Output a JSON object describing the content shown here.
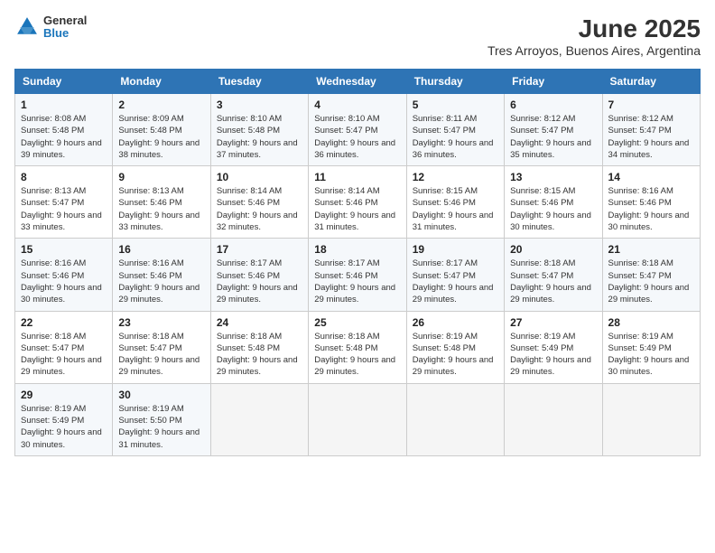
{
  "logo": {
    "general": "General",
    "blue": "Blue"
  },
  "title": "June 2025",
  "subtitle": "Tres Arroyos, Buenos Aires, Argentina",
  "weekdays": [
    "Sunday",
    "Monday",
    "Tuesday",
    "Wednesday",
    "Thursday",
    "Friday",
    "Saturday"
  ],
  "weeks": [
    [
      {
        "day": "1",
        "rise": "Sunrise: 8:08 AM",
        "set": "Sunset: 5:48 PM",
        "daylight": "Daylight: 9 hours and 39 minutes."
      },
      {
        "day": "2",
        "rise": "Sunrise: 8:09 AM",
        "set": "Sunset: 5:48 PM",
        "daylight": "Daylight: 9 hours and 38 minutes."
      },
      {
        "day": "3",
        "rise": "Sunrise: 8:10 AM",
        "set": "Sunset: 5:48 PM",
        "daylight": "Daylight: 9 hours and 37 minutes."
      },
      {
        "day": "4",
        "rise": "Sunrise: 8:10 AM",
        "set": "Sunset: 5:47 PM",
        "daylight": "Daylight: 9 hours and 36 minutes."
      },
      {
        "day": "5",
        "rise": "Sunrise: 8:11 AM",
        "set": "Sunset: 5:47 PM",
        "daylight": "Daylight: 9 hours and 36 minutes."
      },
      {
        "day": "6",
        "rise": "Sunrise: 8:12 AM",
        "set": "Sunset: 5:47 PM",
        "daylight": "Daylight: 9 hours and 35 minutes."
      },
      {
        "day": "7",
        "rise": "Sunrise: 8:12 AM",
        "set": "Sunset: 5:47 PM",
        "daylight": "Daylight: 9 hours and 34 minutes."
      }
    ],
    [
      {
        "day": "8",
        "rise": "Sunrise: 8:13 AM",
        "set": "Sunset: 5:47 PM",
        "daylight": "Daylight: 9 hours and 33 minutes."
      },
      {
        "day": "9",
        "rise": "Sunrise: 8:13 AM",
        "set": "Sunset: 5:46 PM",
        "daylight": "Daylight: 9 hours and 33 minutes."
      },
      {
        "day": "10",
        "rise": "Sunrise: 8:14 AM",
        "set": "Sunset: 5:46 PM",
        "daylight": "Daylight: 9 hours and 32 minutes."
      },
      {
        "day": "11",
        "rise": "Sunrise: 8:14 AM",
        "set": "Sunset: 5:46 PM",
        "daylight": "Daylight: 9 hours and 31 minutes."
      },
      {
        "day": "12",
        "rise": "Sunrise: 8:15 AM",
        "set": "Sunset: 5:46 PM",
        "daylight": "Daylight: 9 hours and 31 minutes."
      },
      {
        "day": "13",
        "rise": "Sunrise: 8:15 AM",
        "set": "Sunset: 5:46 PM",
        "daylight": "Daylight: 9 hours and 30 minutes."
      },
      {
        "day": "14",
        "rise": "Sunrise: 8:16 AM",
        "set": "Sunset: 5:46 PM",
        "daylight": "Daylight: 9 hours and 30 minutes."
      }
    ],
    [
      {
        "day": "15",
        "rise": "Sunrise: 8:16 AM",
        "set": "Sunset: 5:46 PM",
        "daylight": "Daylight: 9 hours and 30 minutes."
      },
      {
        "day": "16",
        "rise": "Sunrise: 8:16 AM",
        "set": "Sunset: 5:46 PM",
        "daylight": "Daylight: 9 hours and 29 minutes."
      },
      {
        "day": "17",
        "rise": "Sunrise: 8:17 AM",
        "set": "Sunset: 5:46 PM",
        "daylight": "Daylight: 9 hours and 29 minutes."
      },
      {
        "day": "18",
        "rise": "Sunrise: 8:17 AM",
        "set": "Sunset: 5:46 PM",
        "daylight": "Daylight: 9 hours and 29 minutes."
      },
      {
        "day": "19",
        "rise": "Sunrise: 8:17 AM",
        "set": "Sunset: 5:47 PM",
        "daylight": "Daylight: 9 hours and 29 minutes."
      },
      {
        "day": "20",
        "rise": "Sunrise: 8:18 AM",
        "set": "Sunset: 5:47 PM",
        "daylight": "Daylight: 9 hours and 29 minutes."
      },
      {
        "day": "21",
        "rise": "Sunrise: 8:18 AM",
        "set": "Sunset: 5:47 PM",
        "daylight": "Daylight: 9 hours and 29 minutes."
      }
    ],
    [
      {
        "day": "22",
        "rise": "Sunrise: 8:18 AM",
        "set": "Sunset: 5:47 PM",
        "daylight": "Daylight: 9 hours and 29 minutes."
      },
      {
        "day": "23",
        "rise": "Sunrise: 8:18 AM",
        "set": "Sunset: 5:47 PM",
        "daylight": "Daylight: 9 hours and 29 minutes."
      },
      {
        "day": "24",
        "rise": "Sunrise: 8:18 AM",
        "set": "Sunset: 5:48 PM",
        "daylight": "Daylight: 9 hours and 29 minutes."
      },
      {
        "day": "25",
        "rise": "Sunrise: 8:18 AM",
        "set": "Sunset: 5:48 PM",
        "daylight": "Daylight: 9 hours and 29 minutes."
      },
      {
        "day": "26",
        "rise": "Sunrise: 8:19 AM",
        "set": "Sunset: 5:48 PM",
        "daylight": "Daylight: 9 hours and 29 minutes."
      },
      {
        "day": "27",
        "rise": "Sunrise: 8:19 AM",
        "set": "Sunset: 5:49 PM",
        "daylight": "Daylight: 9 hours and 29 minutes."
      },
      {
        "day": "28",
        "rise": "Sunrise: 8:19 AM",
        "set": "Sunset: 5:49 PM",
        "daylight": "Daylight: 9 hours and 30 minutes."
      }
    ],
    [
      {
        "day": "29",
        "rise": "Sunrise: 8:19 AM",
        "set": "Sunset: 5:49 PM",
        "daylight": "Daylight: 9 hours and 30 minutes."
      },
      {
        "day": "30",
        "rise": "Sunrise: 8:19 AM",
        "set": "Sunset: 5:50 PM",
        "daylight": "Daylight: 9 hours and 31 minutes."
      },
      {
        "day": "",
        "rise": "",
        "set": "",
        "daylight": ""
      },
      {
        "day": "",
        "rise": "",
        "set": "",
        "daylight": ""
      },
      {
        "day": "",
        "rise": "",
        "set": "",
        "daylight": ""
      },
      {
        "day": "",
        "rise": "",
        "set": "",
        "daylight": ""
      },
      {
        "day": "",
        "rise": "",
        "set": "",
        "daylight": ""
      }
    ]
  ]
}
